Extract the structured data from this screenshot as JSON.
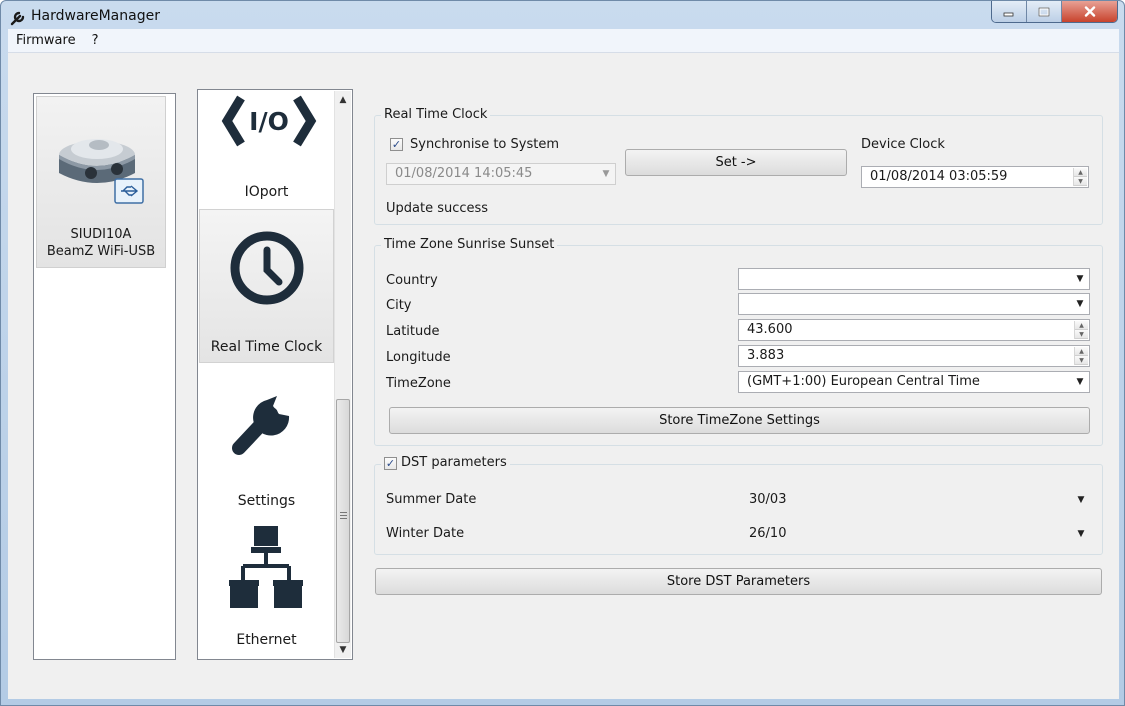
{
  "window": {
    "title": "HardwareManager",
    "icons": [
      "wrench-icon",
      "minimize-icon",
      "maximize-icon",
      "close-icon"
    ]
  },
  "menu": {
    "items": [
      "Firmware",
      "?"
    ]
  },
  "device": {
    "name": "SIUDI10A",
    "model": "BeamZ WiFi-USB",
    "icon": "usb-device-icon"
  },
  "nav": {
    "items": [
      {
        "label": "IOport",
        "icon": "io-port-icon"
      },
      {
        "label": "Real Time Clock",
        "icon": "clock-icon"
      },
      {
        "label": "Settings",
        "icon": "wrench-icon"
      },
      {
        "label": "Ethernet",
        "icon": "network-icon"
      }
    ],
    "selected": "Real Time Clock"
  },
  "rtc": {
    "group_title": "Real Time Clock",
    "sync_label": "Synchronise to System",
    "sync_checked": true,
    "system_time": "01/08/2014 14:05:45",
    "set_button": "Set ->",
    "device_clock_label": "Device Clock",
    "device_clock_value": "01/08/2014 03:05:59",
    "status": "Update success"
  },
  "timezone": {
    "group_title": "Time Zone Sunrise Sunset",
    "country_label": "Country",
    "country_value": "",
    "city_label": "City",
    "city_value": "",
    "latitude_label": "Latitude",
    "latitude_value": "43.600",
    "longitude_label": "Longitude",
    "longitude_value": "3.883",
    "timezone_label": "TimeZone",
    "timezone_value": "(GMT+1:00) European Central Time",
    "store_button": "Store TimeZone Settings"
  },
  "dst": {
    "group_title": "DST parameters",
    "enabled": true,
    "summer_label": "Summer Date",
    "summer_value": "30/03",
    "winter_label": "Winter Date",
    "winter_value": "26/10",
    "store_button": "Store DST Parameters"
  },
  "colors": {
    "title_bar": "#c9dbee",
    "close_button": "#c8432d",
    "icon_dark": "#1e2d3b"
  }
}
